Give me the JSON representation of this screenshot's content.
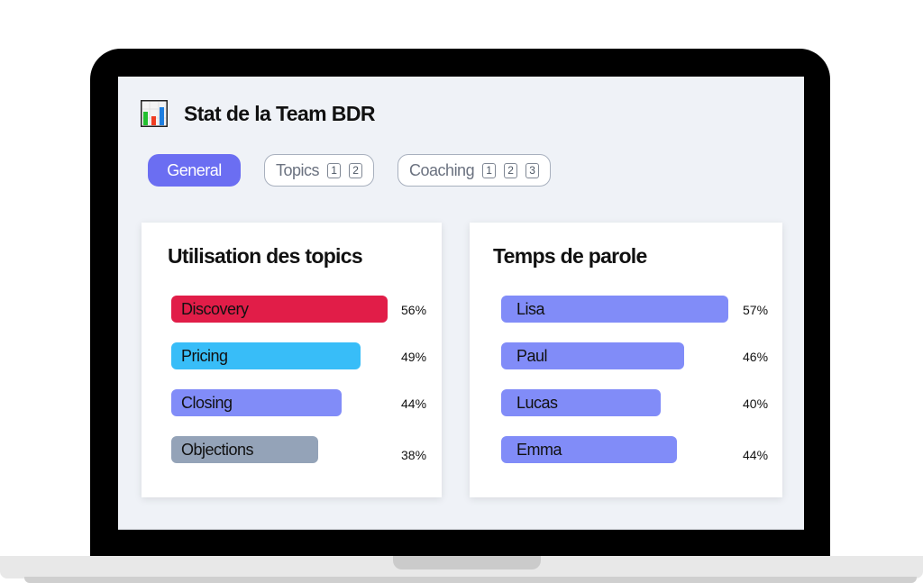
{
  "header": {
    "title": "Stat de la Team BDR",
    "icon": "bar-chart-icon"
  },
  "tabs": [
    {
      "label": "General",
      "active": true,
      "badges": []
    },
    {
      "label": "Topics",
      "active": false,
      "badges": [
        "1",
        "2"
      ]
    },
    {
      "label": "Coaching",
      "active": false,
      "badges": [
        "1",
        "2",
        "3"
      ]
    }
  ],
  "colors": {
    "accent": "#6b6ef2",
    "discovery": "#e11d48",
    "pricing": "#38bdf8",
    "closing": "#818cf8",
    "objections": "#94a3b8",
    "speaker": "#818cf8"
  },
  "chart_data": [
    {
      "type": "bar",
      "title": "Utilisation des topics",
      "categories": [
        "Discovery",
        "Pricing",
        "Closing",
        "Objections"
      ],
      "values": [
        56,
        49,
        44,
        38
      ],
      "labels": [
        "56%",
        "49%",
        "44%",
        "38%"
      ],
      "colors": [
        "#e11d48",
        "#38bdf8",
        "#818cf8",
        "#94a3b8"
      ],
      "xlabel": "",
      "ylabel": ""
    },
    {
      "type": "bar",
      "title": "Temps de parole",
      "categories": [
        "Lisa",
        "Paul",
        "Lucas",
        "Emma"
      ],
      "values": [
        57,
        46,
        40,
        44
      ],
      "labels": [
        "57%",
        "46%",
        "40%",
        "44%"
      ],
      "colors": [
        "#818cf8",
        "#818cf8",
        "#818cf8",
        "#818cf8"
      ],
      "xlabel": "",
      "ylabel": ""
    }
  ]
}
